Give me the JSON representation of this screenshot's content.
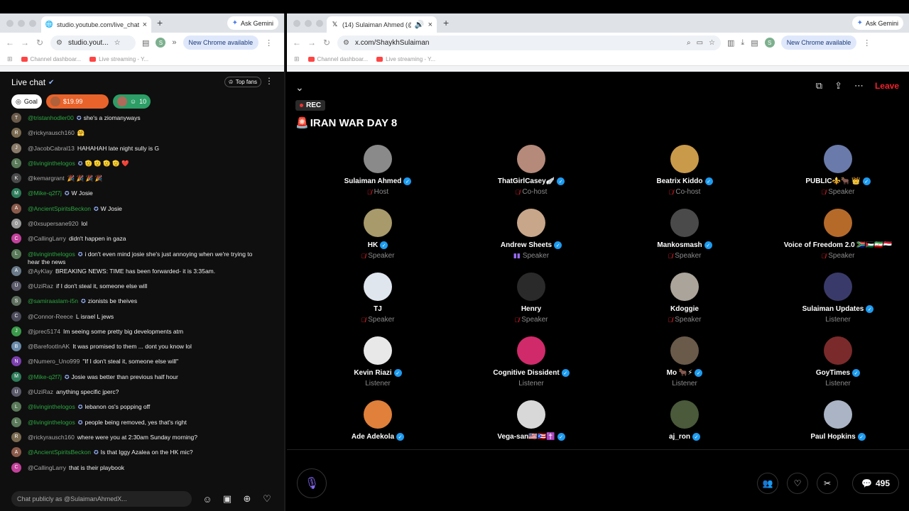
{
  "left_browser": {
    "tab_title": "studio.youtube.com/live_chat",
    "ask_gemini": "Ask Gemini",
    "url": "studio.yout...",
    "update_label": "New Chrome available",
    "bookmarks": [
      "Channel dashboar...",
      "Live streaming - Y..."
    ]
  },
  "right_browser": {
    "tab_title": "(14) Sulaiman Ahmed (@S",
    "ask_gemini": "Ask Gemini",
    "url": "x.com/ShaykhSulaiman",
    "update_label": "New Chrome available",
    "bookmarks": [
      "Channel dashboar...",
      "Live streaming - Y..."
    ]
  },
  "chat": {
    "title": "Live chat",
    "top_fans": "Top fans",
    "goal_label": "Goal",
    "super_chat": "$19.99",
    "members_count": "10",
    "input_placeholder": "Chat publicly as @SulaimanAhmedX...",
    "messages": [
      {
        "user": "@tristanhodler00",
        "text": "she's a ziomanyways",
        "member": true,
        "badge": true,
        "color": "#6b5b4b"
      },
      {
        "user": "@rickyrausch160",
        "text": "🤗",
        "member": false,
        "badge": false,
        "color": "#7a6a50"
      },
      {
        "user": "@JacobCabral13",
        "text": "HAHAHAH late night sully is G",
        "member": false,
        "badge": false,
        "color": "#8a7a6a"
      },
      {
        "user": "@livinginthelogos",
        "text": "🫡 🫡 🫡 🫡 ❤️",
        "member": true,
        "badge": true,
        "color": "#5a7a5a"
      },
      {
        "user": "@kemargrant",
        "text": "🎉 🎉 🎉 🎉",
        "member": false,
        "badge": false,
        "color": "#4a4a4a"
      },
      {
        "user": "@Mike-q2f7j",
        "text": "W Josie",
        "member": true,
        "badge": true,
        "color": "#2e7d5b"
      },
      {
        "user": "@AncientSpiritsBeckon",
        "text": "W Josie",
        "member": true,
        "badge": true,
        "color": "#8a5a4a"
      },
      {
        "user": "@0xsupersane920",
        "text": "lol",
        "member": false,
        "badge": false,
        "color": "#9a9a9a"
      },
      {
        "user": "@CallingLarry",
        "text": "didn't happen in gaza",
        "member": false,
        "badge": false,
        "color": "#c2419b"
      },
      {
        "user": "@livinginthelogos",
        "text": "i don't even mind josie she's just annoying when we're trying to hear the news",
        "member": true,
        "badge": true,
        "color": "#5a7a5a"
      },
      {
        "user": "@AyKlay",
        "text": "BREAKING NEWS: TIME has been forwarded- it is 3:35am.",
        "member": false,
        "badge": false,
        "color": "#6a7a8a"
      },
      {
        "user": "@UziRaz",
        "text": "if I don't steal it, someone else will",
        "member": false,
        "badge": false,
        "color": "#5a5a6a"
      },
      {
        "user": "@samiraaslam-i5n",
        "text": "zionists be theives",
        "member": true,
        "badge": true,
        "color": "#5e6e5e"
      },
      {
        "user": "@Connor-Reece",
        "text": "L israel L jews",
        "member": false,
        "badge": false,
        "color": "#4a4a5a"
      },
      {
        "user": "@jprec5174",
        "text": "Im seeing some pretty big developments atm",
        "member": false,
        "badge": false,
        "color": "#3a9a4a"
      },
      {
        "user": "@BarefootInAK",
        "text": "It was promised to them ... dont you know lol",
        "member": false,
        "badge": false,
        "color": "#6a8aaa"
      },
      {
        "user": "@Numero_Uno999",
        "text": "\"If I don't steal it, someone else will\"",
        "member": false,
        "badge": false,
        "color": "#7b3fb0"
      },
      {
        "user": "@Mike-q2f7j",
        "text": "Josie was better than previous half hour",
        "member": true,
        "badge": true,
        "color": "#2e7d5b"
      },
      {
        "user": "@UziRaz",
        "text": "anything specific jperc?",
        "member": false,
        "badge": false,
        "color": "#5a5a6a"
      },
      {
        "user": "@livinginthelogos",
        "text": "lebanon os's popping off",
        "member": true,
        "badge": true,
        "color": "#5a7a5a"
      },
      {
        "user": "@livinginthelogos",
        "text": "people being removed, yes that's right",
        "member": true,
        "badge": true,
        "color": "#5a7a5a"
      },
      {
        "user": "@rickyrausch160",
        "text": "where were you at 2:30am Sunday morning?",
        "member": false,
        "badge": false,
        "color": "#7a6a50"
      },
      {
        "user": "@AncientSpiritsBeckon",
        "text": "Is that Iggy Azalea on the HK mic?",
        "member": true,
        "badge": true,
        "color": "#8a5a4a"
      },
      {
        "user": "@CallingLarry",
        "text": "that is their playbook",
        "member": false,
        "badge": false,
        "color": "#c2419b"
      }
    ]
  },
  "space": {
    "leave": "Leave",
    "rec": "REC",
    "title": "IRAN WAR DAY 8",
    "reply_count": "495",
    "speakers": [
      {
        "name": "Sulaiman Ahmed",
        "role": "Host",
        "verified": true,
        "status": "muted",
        "color": "#8a8a8a"
      },
      {
        "name": "ThatGirlCasey🪽",
        "role": "Co-host",
        "verified": true,
        "status": "muted",
        "color": "#b58a7a"
      },
      {
        "name": "Beatrix Kiddo",
        "role": "Co-host",
        "verified": true,
        "status": "muted",
        "color": "#c99a4a"
      },
      {
        "name": "PUBLIC⚜️🐂 👑",
        "role": "Speaker",
        "verified": true,
        "status": "muted",
        "color": "#6a7aaa"
      },
      {
        "name": "HK",
        "role": "Speaker",
        "verified": true,
        "status": "muted",
        "color": "#a89a6a"
      },
      {
        "name": "Andrew Sheets",
        "role": "Speaker",
        "verified": true,
        "status": "talking",
        "color": "#c8a68a"
      },
      {
        "name": "Mankosmash",
        "role": "Speaker",
        "verified": true,
        "status": "muted",
        "color": "#4a4a4a"
      },
      {
        "name": "Voice of Freedom 2.0 🇿🇦🇵🇸🇮🇷🇾🇪",
        "role": "Speaker",
        "verified": false,
        "status": "muted",
        "color": "#b56a2a"
      },
      {
        "name": "TJ",
        "role": "Speaker",
        "verified": false,
        "status": "muted",
        "color": "#dfe6ee"
      },
      {
        "name": "Henry",
        "role": "Speaker",
        "verified": false,
        "status": "muted",
        "color": "#2a2a2a"
      },
      {
        "name": "Kdoggie",
        "role": "Speaker",
        "verified": false,
        "status": "muted",
        "color": "#aaa49a"
      },
      {
        "name": "Sulaiman Updates",
        "role": "Listener",
        "verified": true,
        "status": "",
        "color": "#3a3a6a"
      },
      {
        "name": "Kevin Riazi",
        "role": "Listener",
        "verified": true,
        "status": "",
        "color": "#e8e8e8"
      },
      {
        "name": "Cognitive Dissident",
        "role": "Listener",
        "verified": true,
        "status": "",
        "color": "#d02a6a"
      },
      {
        "name": "Mo 🐂⚡",
        "role": "Listener",
        "verified": true,
        "status": "",
        "color": "#6a5a4a"
      },
      {
        "name": "GoyTimes",
        "role": "Listener",
        "verified": true,
        "status": "",
        "color": "#7a2a2a"
      },
      {
        "name": "Ade Adekola",
        "role": "",
        "verified": true,
        "status": "",
        "color": "#e0803a"
      },
      {
        "name": "Vega-san🇺🇸🇵🇷✝️",
        "role": "",
        "verified": true,
        "status": "",
        "color": "#d8d8d8"
      },
      {
        "name": "aj_ron",
        "role": "",
        "verified": true,
        "status": "",
        "color": "#4a5a3a"
      },
      {
        "name": "Paul Hopkins",
        "role": "",
        "verified": true,
        "status": "",
        "color": "#aab4c4"
      }
    ]
  }
}
